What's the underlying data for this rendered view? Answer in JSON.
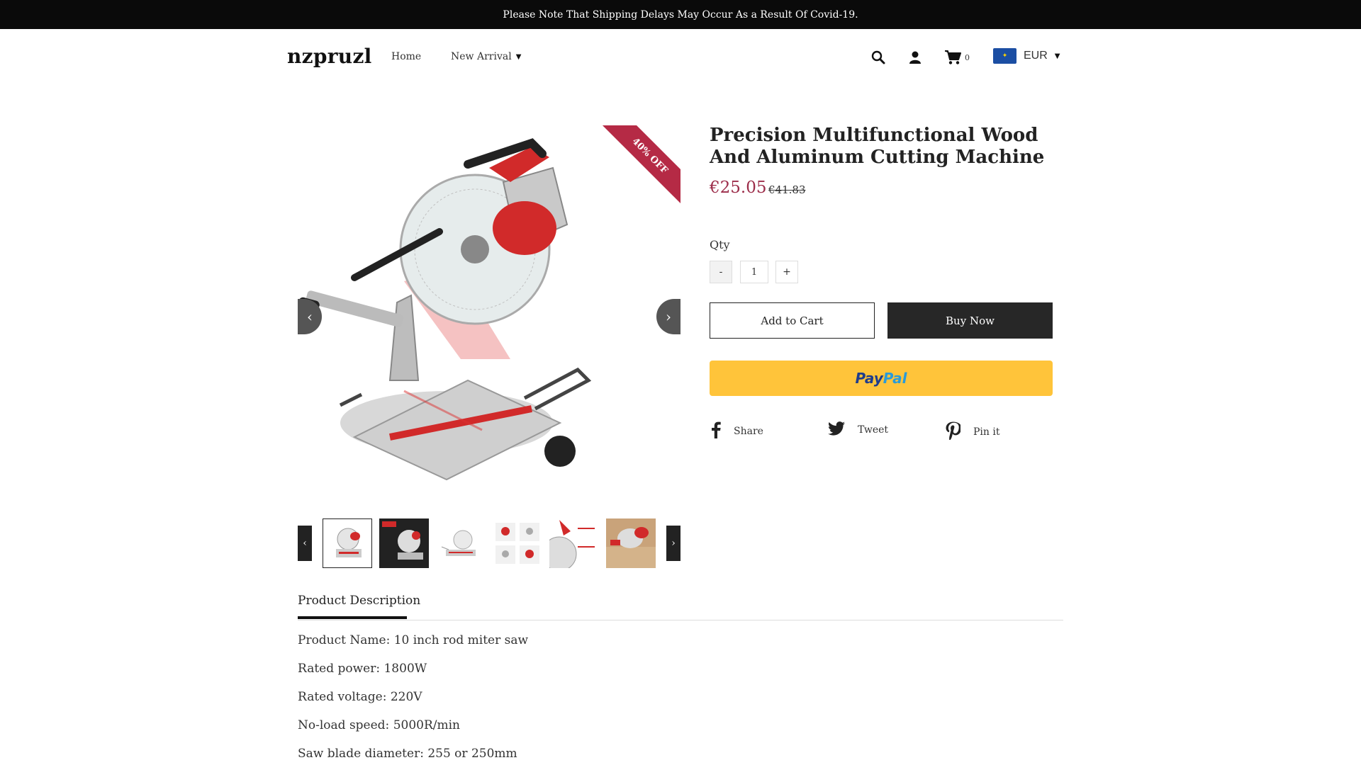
{
  "announcement": "Please Note That Shipping Delays May Occur As a Result Of Covid-19.",
  "header": {
    "logo": "nzpruzl",
    "nav": [
      {
        "label": "Home"
      },
      {
        "label": "New Arrival"
      }
    ],
    "icons": [
      "search-icon",
      "account-icon",
      "cart-icon"
    ],
    "cart_count": "0",
    "currency": "EUR"
  },
  "gallery": {
    "sale_badge": "40% OFF",
    "thumbnail_count": 6
  },
  "product": {
    "title": "Precision Multifunctional Wood And Aluminum Cutting Machine",
    "price": "€25.05",
    "compare_price": "€41.83",
    "qty_label": "Qty",
    "qty_value": "1",
    "minus_label": "-",
    "plus_label": "+",
    "add_to_cart": "Add to Cart",
    "buy_now": "Buy Now",
    "paypal_part1": "Pay",
    "paypal_part2": "Pal"
  },
  "share": {
    "facebook": "Share",
    "twitter": "Tweet",
    "pinterest": "Pin it"
  },
  "tabs": {
    "description": "Product Description"
  },
  "description_lines": [
    "Product Name: 10 inch rod miter saw",
    "Rated power: 1800W",
    "Rated voltage: 220V",
    "No-load speed: 5000R/min",
    "Saw blade diameter: 255 or 250mm"
  ],
  "colors": {
    "price": "#9c2d4a",
    "badge": "#b52a45",
    "paypal": "#ffc43a",
    "buy_now": "#272727"
  }
}
